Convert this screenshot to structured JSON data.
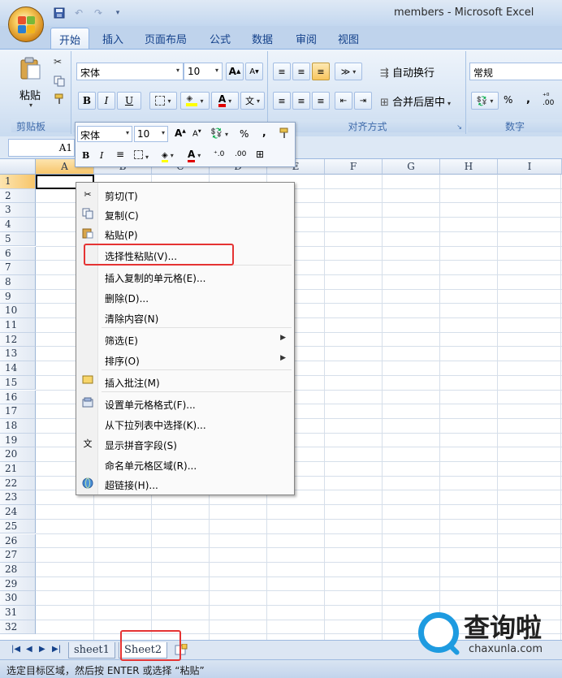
{
  "window": {
    "title": "members - Microsoft Excel"
  },
  "ribbon_tabs": [
    "开始",
    "插入",
    "页面布局",
    "公式",
    "数据",
    "审阅",
    "视图"
  ],
  "ribbon": {
    "clipboard": {
      "paste": "粘贴",
      "label": "剪贴板"
    },
    "font": {
      "name": "宋体",
      "size": "10",
      "grow": "A",
      "shrink": "A",
      "bold": "B",
      "italic": "I",
      "underline": "U"
    },
    "alignment": {
      "wrap": "自动换行",
      "merge": "合并后居中",
      "label": "对齐方式"
    },
    "number": {
      "format": "常规",
      "percent": "%",
      "comma": ",",
      "label": "数字"
    }
  },
  "formula_bar": {
    "name_box": "A1"
  },
  "columns": [
    "A",
    "B",
    "C",
    "D",
    "E",
    "F",
    "G",
    "H",
    "I"
  ],
  "rows": [
    "1",
    "2",
    "3",
    "4",
    "5",
    "6",
    "7",
    "8",
    "9",
    "10",
    "11",
    "12",
    "13",
    "14",
    "15",
    "16",
    "17",
    "18",
    "19",
    "20",
    "21",
    "22",
    "23",
    "24",
    "25",
    "26",
    "27",
    "28",
    "29",
    "30",
    "31",
    "32"
  ],
  "mini_toolbar": {
    "font": "宋体",
    "size": "10",
    "bold": "B",
    "italic": "I",
    "percent": "%",
    "comma": ","
  },
  "context_menu": [
    {
      "label": "剪切(T)",
      "icon": "scissors-icon"
    },
    {
      "label": "复制(C)",
      "icon": "copy-icon"
    },
    {
      "label": "粘贴(P)",
      "icon": "paste-icon"
    },
    {
      "label": "选择性粘贴(V)...",
      "icon": ""
    },
    {
      "label": "插入复制的单元格(E)...",
      "icon": ""
    },
    {
      "label": "删除(D)...",
      "icon": ""
    },
    {
      "label": "清除内容(N)",
      "icon": ""
    },
    {
      "label": "筛选(E)",
      "icon": "",
      "submenu": true
    },
    {
      "label": "排序(O)",
      "icon": "",
      "submenu": true
    },
    {
      "label": "插入批注(M)",
      "icon": "comment-icon"
    },
    {
      "label": "设置单元格格式(F)...",
      "icon": "format-cells-icon"
    },
    {
      "label": "从下拉列表中选择(K)...",
      "icon": ""
    },
    {
      "label": "显示拼音字段(S)",
      "icon": "phonetic-icon"
    },
    {
      "label": "命名单元格区域(R)...",
      "icon": ""
    },
    {
      "label": "超链接(H)...",
      "icon": "hyperlink-icon"
    }
  ],
  "sheet_tabs": [
    "sheet1",
    "Sheet2"
  ],
  "status_bar": {
    "text": "选定目标区域，然后按 ENTER 或选择 “粘贴”"
  },
  "watermark": {
    "text": "查询啦",
    "url": "chaxunla.com"
  }
}
